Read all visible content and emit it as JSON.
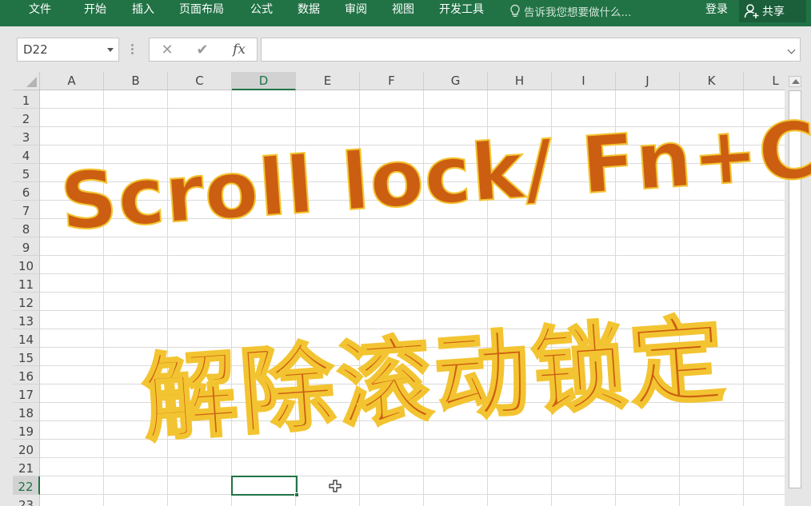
{
  "ribbon": {
    "tabs": [
      "文件",
      "开始",
      "插入",
      "页面布局",
      "公式",
      "数据",
      "审阅",
      "视图",
      "开发工具"
    ],
    "tell_me": "告诉我您想要做什么...",
    "login": "登录",
    "share": "共享"
  },
  "formula_bar": {
    "name_box": "D22",
    "formula": ""
  },
  "sheet": {
    "columns": [
      "A",
      "B",
      "C",
      "D",
      "E",
      "F",
      "G",
      "H",
      "I",
      "J",
      "K",
      "L"
    ],
    "rows": [
      "1",
      "2",
      "3",
      "4",
      "5",
      "6",
      "7",
      "8",
      "9",
      "10",
      "11",
      "12",
      "13",
      "14",
      "15",
      "16",
      "17",
      "18",
      "19",
      "20",
      "21",
      "22",
      "23"
    ],
    "active_column": "D",
    "active_row": "22",
    "active_cell": "D22"
  },
  "overlay": {
    "line1": "Scroll lock/ Fn+C",
    "line2": "解除滚动锁定",
    "text_color": "#cc5e12",
    "outline_color": "#f3c431"
  },
  "colors": {
    "accent": "#217346"
  }
}
